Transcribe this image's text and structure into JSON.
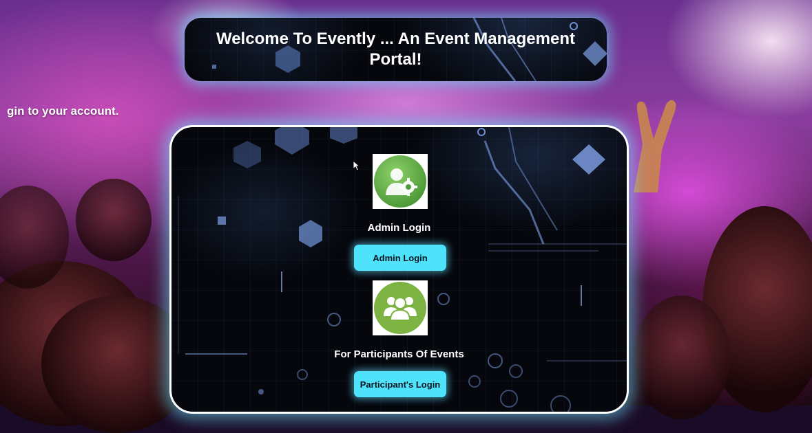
{
  "header": {
    "title": "Welcome To Evently ... An Event Management Portal!"
  },
  "side_text": "gin to your account.",
  "admin": {
    "icon": "admin-settings-icon",
    "label": "Admin Login",
    "button_label": "Admin Login"
  },
  "participant": {
    "icon": "group-users-icon",
    "label": "For Participants Of Events",
    "button_label": "Participant's Login"
  },
  "colors": {
    "button": "#4fe3fb",
    "glow": "#6ee1ff",
    "admin_icon_green": "#4f9d3a",
    "participant_icon_green": "#7cb342",
    "panel_bg": "#05070c"
  }
}
